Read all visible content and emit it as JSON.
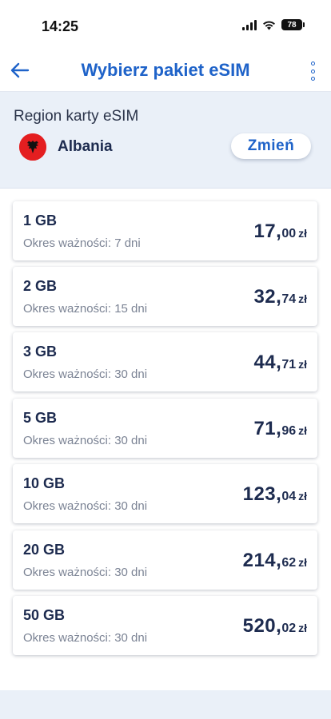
{
  "status_bar": {
    "time": "14:25",
    "battery": "78"
  },
  "header": {
    "title": "Wybierz pakiet eSIM"
  },
  "region": {
    "label": "Region karty eSIM",
    "country": "Albania",
    "change_label": "Zmień"
  },
  "packages": [
    {
      "data": "1 GB",
      "validity": "Okres ważności: 7 dni",
      "price_main": "17,",
      "price_cents": "00",
      "currency": "zł"
    },
    {
      "data": "2 GB",
      "validity": "Okres ważności: 15 dni",
      "price_main": "32,",
      "price_cents": "74",
      "currency": "zł"
    },
    {
      "data": "3 GB",
      "validity": "Okres ważności: 30 dni",
      "price_main": "44,",
      "price_cents": "71",
      "currency": "zł"
    },
    {
      "data": "5 GB",
      "validity": "Okres ważności: 30 dni",
      "price_main": "71,",
      "price_cents": "96",
      "currency": "zł"
    },
    {
      "data": "10 GB",
      "validity": "Okres ważności: 30 dni",
      "price_main": "123,",
      "price_cents": "04",
      "currency": "zł"
    },
    {
      "data": "20 GB",
      "validity": "Okres ważności: 30 dni",
      "price_main": "214,",
      "price_cents": "62",
      "currency": "zł"
    },
    {
      "data": "50 GB",
      "validity": "Okres ważności: 30 dni",
      "price_main": "520,",
      "price_cents": "02",
      "currency": "zł"
    }
  ],
  "colors": {
    "accent": "#1f63c9",
    "text_dark": "#1d2b4f",
    "region_bg": "#eaf0f8"
  },
  "icons": {
    "back": "arrow-left-icon",
    "menu": "more-vertical-icon",
    "flag": "albania-flag-icon"
  }
}
